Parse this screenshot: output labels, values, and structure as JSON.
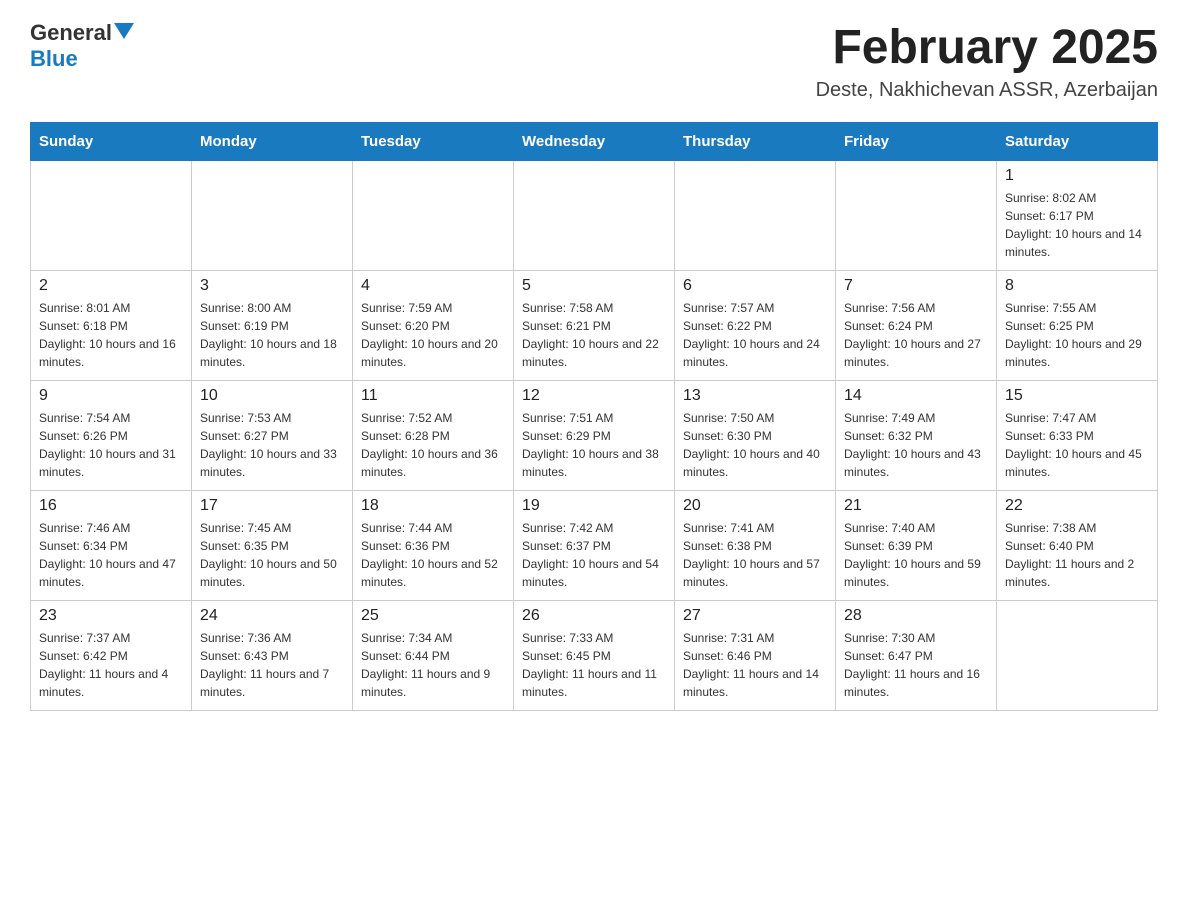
{
  "header": {
    "logo_general": "General",
    "logo_blue": "Blue",
    "month_title": "February 2025",
    "location": "Deste, Nakhichevan ASSR, Azerbaijan"
  },
  "weekdays": [
    "Sunday",
    "Monday",
    "Tuesday",
    "Wednesday",
    "Thursday",
    "Friday",
    "Saturday"
  ],
  "weeks": [
    [
      {
        "day": "",
        "info": ""
      },
      {
        "day": "",
        "info": ""
      },
      {
        "day": "",
        "info": ""
      },
      {
        "day": "",
        "info": ""
      },
      {
        "day": "",
        "info": ""
      },
      {
        "day": "",
        "info": ""
      },
      {
        "day": "1",
        "info": "Sunrise: 8:02 AM\nSunset: 6:17 PM\nDaylight: 10 hours and 14 minutes."
      }
    ],
    [
      {
        "day": "2",
        "info": "Sunrise: 8:01 AM\nSunset: 6:18 PM\nDaylight: 10 hours and 16 minutes."
      },
      {
        "day": "3",
        "info": "Sunrise: 8:00 AM\nSunset: 6:19 PM\nDaylight: 10 hours and 18 minutes."
      },
      {
        "day": "4",
        "info": "Sunrise: 7:59 AM\nSunset: 6:20 PM\nDaylight: 10 hours and 20 minutes."
      },
      {
        "day": "5",
        "info": "Sunrise: 7:58 AM\nSunset: 6:21 PM\nDaylight: 10 hours and 22 minutes."
      },
      {
        "day": "6",
        "info": "Sunrise: 7:57 AM\nSunset: 6:22 PM\nDaylight: 10 hours and 24 minutes."
      },
      {
        "day": "7",
        "info": "Sunrise: 7:56 AM\nSunset: 6:24 PM\nDaylight: 10 hours and 27 minutes."
      },
      {
        "day": "8",
        "info": "Sunrise: 7:55 AM\nSunset: 6:25 PM\nDaylight: 10 hours and 29 minutes."
      }
    ],
    [
      {
        "day": "9",
        "info": "Sunrise: 7:54 AM\nSunset: 6:26 PM\nDaylight: 10 hours and 31 minutes."
      },
      {
        "day": "10",
        "info": "Sunrise: 7:53 AM\nSunset: 6:27 PM\nDaylight: 10 hours and 33 minutes."
      },
      {
        "day": "11",
        "info": "Sunrise: 7:52 AM\nSunset: 6:28 PM\nDaylight: 10 hours and 36 minutes."
      },
      {
        "day": "12",
        "info": "Sunrise: 7:51 AM\nSunset: 6:29 PM\nDaylight: 10 hours and 38 minutes."
      },
      {
        "day": "13",
        "info": "Sunrise: 7:50 AM\nSunset: 6:30 PM\nDaylight: 10 hours and 40 minutes."
      },
      {
        "day": "14",
        "info": "Sunrise: 7:49 AM\nSunset: 6:32 PM\nDaylight: 10 hours and 43 minutes."
      },
      {
        "day": "15",
        "info": "Sunrise: 7:47 AM\nSunset: 6:33 PM\nDaylight: 10 hours and 45 minutes."
      }
    ],
    [
      {
        "day": "16",
        "info": "Sunrise: 7:46 AM\nSunset: 6:34 PM\nDaylight: 10 hours and 47 minutes."
      },
      {
        "day": "17",
        "info": "Sunrise: 7:45 AM\nSunset: 6:35 PM\nDaylight: 10 hours and 50 minutes."
      },
      {
        "day": "18",
        "info": "Sunrise: 7:44 AM\nSunset: 6:36 PM\nDaylight: 10 hours and 52 minutes."
      },
      {
        "day": "19",
        "info": "Sunrise: 7:42 AM\nSunset: 6:37 PM\nDaylight: 10 hours and 54 minutes."
      },
      {
        "day": "20",
        "info": "Sunrise: 7:41 AM\nSunset: 6:38 PM\nDaylight: 10 hours and 57 minutes."
      },
      {
        "day": "21",
        "info": "Sunrise: 7:40 AM\nSunset: 6:39 PM\nDaylight: 10 hours and 59 minutes."
      },
      {
        "day": "22",
        "info": "Sunrise: 7:38 AM\nSunset: 6:40 PM\nDaylight: 11 hours and 2 minutes."
      }
    ],
    [
      {
        "day": "23",
        "info": "Sunrise: 7:37 AM\nSunset: 6:42 PM\nDaylight: 11 hours and 4 minutes."
      },
      {
        "day": "24",
        "info": "Sunrise: 7:36 AM\nSunset: 6:43 PM\nDaylight: 11 hours and 7 minutes."
      },
      {
        "day": "25",
        "info": "Sunrise: 7:34 AM\nSunset: 6:44 PM\nDaylight: 11 hours and 9 minutes."
      },
      {
        "day": "26",
        "info": "Sunrise: 7:33 AM\nSunset: 6:45 PM\nDaylight: 11 hours and 11 minutes."
      },
      {
        "day": "27",
        "info": "Sunrise: 7:31 AM\nSunset: 6:46 PM\nDaylight: 11 hours and 14 minutes."
      },
      {
        "day": "28",
        "info": "Sunrise: 7:30 AM\nSunset: 6:47 PM\nDaylight: 11 hours and 16 minutes."
      },
      {
        "day": "",
        "info": ""
      }
    ]
  ]
}
